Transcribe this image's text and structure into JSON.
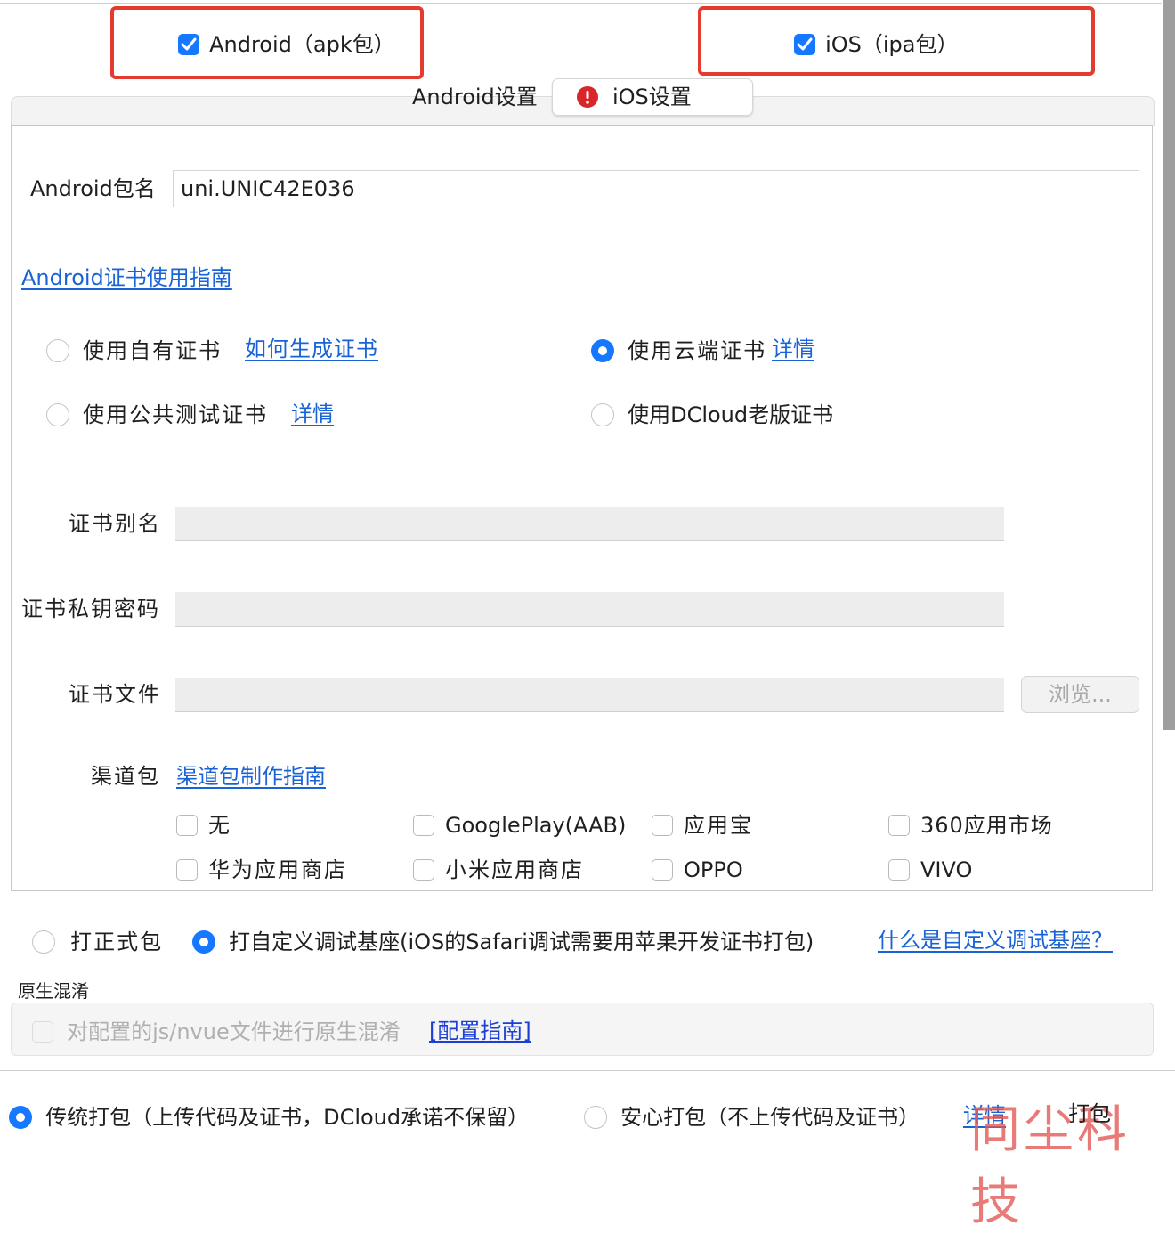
{
  "platforms": {
    "android": {
      "label": "Android（apk包）",
      "checked": true
    },
    "ios": {
      "label": "iOS（ipa包）",
      "checked": true
    }
  },
  "tabs": {
    "android": "Android设置",
    "ios": "iOS设置",
    "ios_warning_icon": "exclamation-warning-icon"
  },
  "android": {
    "package_label": "Android包名",
    "package_value": "uni.UNIC42E036",
    "cert_guide_link": "Android证书使用指南",
    "cert_options": [
      {
        "label": "使用自有证书",
        "link": "如何生成证书",
        "selected": false
      },
      {
        "label": "使用云端证书",
        "link": "详情",
        "selected": true
      },
      {
        "label": "使用公共测试证书",
        "link": "详情",
        "selected": false
      },
      {
        "label": "使用DCloud老版证书",
        "link": "",
        "selected": false
      }
    ],
    "alias_label": "证书别名",
    "alias_value": "",
    "key_password_label": "证书私钥密码",
    "key_password_value": "",
    "cert_file_label": "证书文件",
    "cert_file_value": "",
    "browse_button": "浏览...",
    "channel_label": "渠道包",
    "channel_guide_link": "渠道包制作指南",
    "channels": [
      {
        "label": "无",
        "checked": false
      },
      {
        "label": "GooglePlay(AAB)",
        "checked": false
      },
      {
        "label": "应用宝",
        "checked": false
      },
      {
        "label": "360应用市场",
        "checked": false
      },
      {
        "label": "华为应用商店",
        "checked": false
      },
      {
        "label": "小米应用商店",
        "checked": false
      },
      {
        "label": "OPPO",
        "checked": false
      },
      {
        "label": "VIVO",
        "checked": false
      }
    ]
  },
  "build_type": {
    "formal": {
      "label": "打正式包",
      "selected": false
    },
    "custom_base": {
      "label": "打自定义调试基座(iOS的Safari调试需要用苹果开发证书打包)",
      "selected": true
    },
    "help_link": "什么是自定义调试基座？"
  },
  "obfuscation": {
    "section_title": "原生混淆",
    "checkbox_label": "对配置的js/nvue文件进行原生混淆",
    "checked": false,
    "guide_link": "[配置指南]"
  },
  "footer": {
    "traditional": {
      "label": "传统打包（上传代码及证书，DCloud承诺不保留）",
      "selected": true
    },
    "safe": {
      "label": "安心打包（不上传代码及证书）",
      "selected": false
    },
    "details_link": "详情",
    "pack_button": "打包",
    "watermark": "同尘科技"
  },
  "colors": {
    "accent": "#1677ff",
    "link": "#1a63d6",
    "highlight_box": "#e53a2e"
  }
}
